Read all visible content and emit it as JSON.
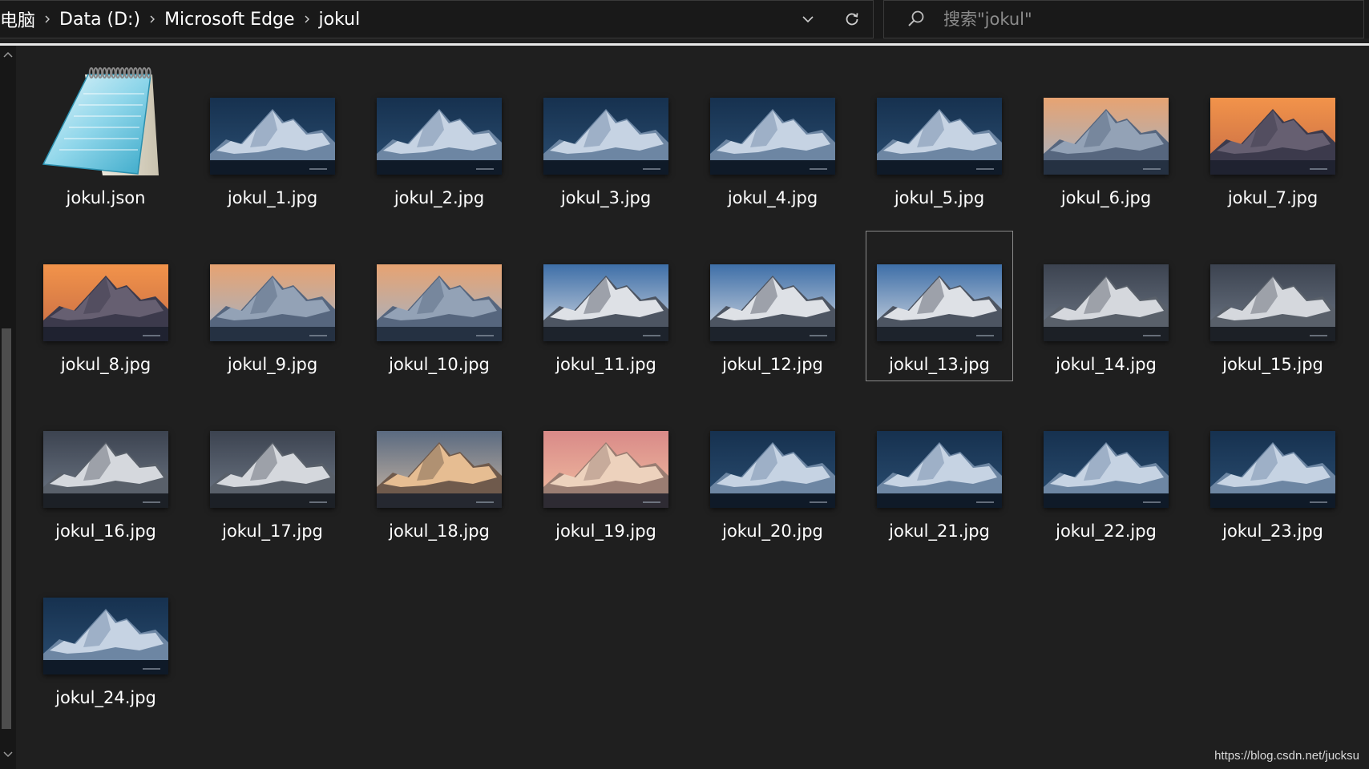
{
  "address_bar": {
    "breadcrumbs": [
      "电脑",
      "Data (D:)",
      "Microsoft Edge",
      "jokul"
    ]
  },
  "search": {
    "placeholder": "搜索\"jokul\""
  },
  "files": [
    {
      "name": "jokul.json",
      "type": "json"
    },
    {
      "name": "jokul_1.jpg",
      "palette": "blue"
    },
    {
      "name": "jokul_2.jpg",
      "palette": "blue"
    },
    {
      "name": "jokul_3.jpg",
      "palette": "blue"
    },
    {
      "name": "jokul_4.jpg",
      "palette": "blue"
    },
    {
      "name": "jokul_5.jpg",
      "palette": "blue"
    },
    {
      "name": "jokul_6.jpg",
      "palette": "dusk"
    },
    {
      "name": "jokul_7.jpg",
      "palette": "orange"
    },
    {
      "name": "jokul_8.jpg",
      "palette": "orange"
    },
    {
      "name": "jokul_9.jpg",
      "palette": "dusk"
    },
    {
      "name": "jokul_10.jpg",
      "palette": "dusk"
    },
    {
      "name": "jokul_11.jpg",
      "palette": "clouds"
    },
    {
      "name": "jokul_12.jpg",
      "palette": "clouds"
    },
    {
      "name": "jokul_13.jpg",
      "palette": "clouds",
      "selected": true
    },
    {
      "name": "jokul_14.jpg",
      "palette": "grey"
    },
    {
      "name": "jokul_15.jpg",
      "palette": "grey"
    },
    {
      "name": "jokul_16.jpg",
      "palette": "grey"
    },
    {
      "name": "jokul_17.jpg",
      "palette": "grey"
    },
    {
      "name": "jokul_18.jpg",
      "palette": "gold"
    },
    {
      "name": "jokul_19.jpg",
      "palette": "pink"
    },
    {
      "name": "jokul_20.jpg",
      "palette": "blue"
    },
    {
      "name": "jokul_21.jpg",
      "palette": "blue"
    },
    {
      "name": "jokul_22.jpg",
      "palette": "blue"
    },
    {
      "name": "jokul_23.jpg",
      "palette": "blue"
    },
    {
      "name": "jokul_24.jpg",
      "palette": "blue"
    }
  ],
  "palettes": {
    "blue": {
      "sky1": "#16314f",
      "sky2": "#2c4f73",
      "snow": "#cfdcea",
      "shade": "#6d86a3",
      "ground": "#0f1a28"
    },
    "dusk": {
      "sky1": "#e7a372",
      "sky2": "#9fb3c9",
      "snow": "#9aa9bd",
      "shade": "#56667e",
      "ground": "#253142"
    },
    "orange": {
      "sky1": "#f2934a",
      "sky2": "#c46a45",
      "snow": "#6a6476",
      "shade": "#3c3a4c",
      "ground": "#1f2230"
    },
    "clouds": {
      "sky1": "#3e6fa8",
      "sky2": "#d9dde4",
      "snow": "#eef1f5",
      "shade": "#4d5562",
      "ground": "#1d232c"
    },
    "grey": {
      "sky1": "#3c4350",
      "sky2": "#707a88",
      "snow": "#e2e6ea",
      "shade": "#59606a",
      "ground": "#1c2026"
    },
    "gold": {
      "sky1": "#5a6a80",
      "sky2": "#cdb9a6",
      "snow": "#f3c89a",
      "shade": "#6f5a4c",
      "ground": "#252830"
    },
    "pink": {
      "sky1": "#d98a88",
      "sky2": "#f2c0a2",
      "snow": "#f6dcc5",
      "shade": "#9a7d72",
      "ground": "#2e2b33"
    }
  },
  "watermark": "https://blog.csdn.net/jucksu"
}
